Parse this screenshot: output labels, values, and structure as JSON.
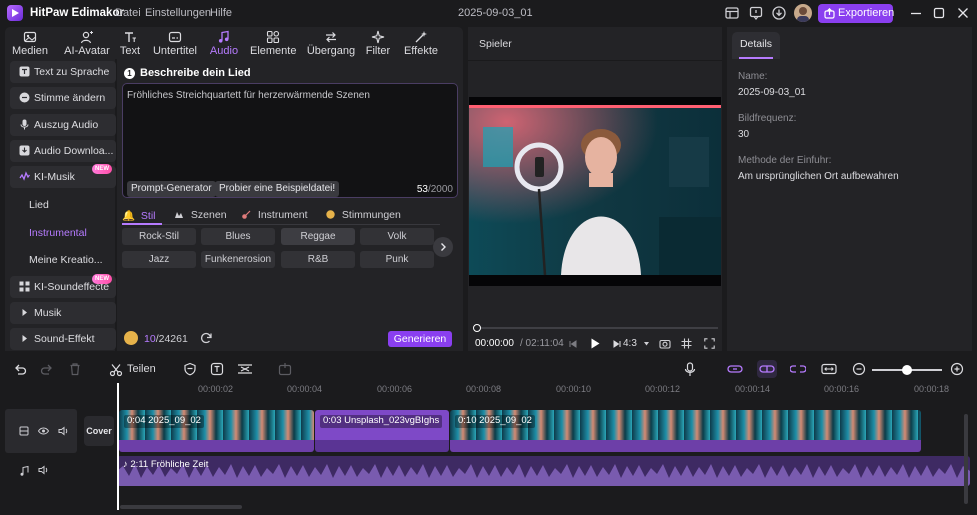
{
  "app": {
    "name": "HitPaw Edimakor",
    "menu": [
      "Datei",
      "Einstellungen",
      "Hilfe"
    ],
    "project_title": "2025-09-03_01",
    "export_label": "Exportieren"
  },
  "tool_tabs": [
    {
      "label": "Medien",
      "icon": "media-icon"
    },
    {
      "label": "AI-Avatar",
      "icon": "avatar-icon"
    },
    {
      "label": "Text",
      "icon": "text-icon"
    },
    {
      "label": "Untertitel",
      "icon": "subtitle-icon"
    },
    {
      "label": "Audio",
      "icon": "music-note-icon",
      "active": true
    },
    {
      "label": "Elemente",
      "icon": "elements-icon"
    },
    {
      "label": "Übergang",
      "icon": "transition-icon"
    },
    {
      "label": "Filter",
      "icon": "filter-icon"
    },
    {
      "label": "Effekte",
      "icon": "effects-icon"
    }
  ],
  "sidebar": {
    "items": [
      {
        "label": "Text zu Sprache",
        "icon": "text-to-speech-icon"
      },
      {
        "label": "Stimme ändern",
        "icon": "voice-change-icon"
      },
      {
        "label": "Auszug Audio",
        "icon": "microphone-icon"
      },
      {
        "label": "Audio Downloa...",
        "icon": "audio-download-icon"
      },
      {
        "label": "KI-Musik",
        "icon": "ai-music-icon",
        "badge": "NEW"
      }
    ],
    "sub_items": [
      {
        "label": "Lied"
      },
      {
        "label": "Instrumental",
        "active": true
      },
      {
        "label": "Meine Kreatio..."
      }
    ],
    "items_bottom": [
      {
        "label": "KI-Soundeffecte",
        "icon": "ai-sound-icon",
        "badge": "NEW"
      },
      {
        "label": "Musik",
        "icon": "caret-right-icon"
      },
      {
        "label": "Sound-Effekt",
        "icon": "caret-right-icon"
      }
    ]
  },
  "music_panel": {
    "step": "1",
    "title": "Beschreibe dein Lied",
    "prompt": "Fröhliches Streichquartett für herzerwärmende Szenen",
    "prompt_generator": "Prompt-Generator",
    "example_button": "Probier eine Beispieldatei!",
    "char_count": "53",
    "char_max": "/2000",
    "style_tabs": [
      "Stil",
      "Szenen",
      "Instrument",
      "Stimmungen"
    ],
    "chips": [
      "Rock-Stil",
      "Blues",
      "Reggae",
      "Volk",
      "Jazz",
      "Funkenerosion",
      "R&B",
      "Punk"
    ],
    "credits_used": "10",
    "credits_total": "/24261",
    "generate_label": "Generieren"
  },
  "player": {
    "title": "Spieler",
    "time_current": "00:00:00",
    "time_total": "/ 02:11:04",
    "aspect": "4:3"
  },
  "details": {
    "tab": "Details",
    "name_label": "Name:",
    "name_value": "2025-09-03_01",
    "fps_label": "Bildfrequenz:",
    "fps_value": "30",
    "import_label": "Methode der Einfuhr:",
    "import_value": "Am ursprünglichen Ort aufbewahren"
  },
  "timeline": {
    "split_label": "Teilen",
    "ticks": [
      "02",
      "04",
      "06",
      "08",
      "10",
      "12",
      "14",
      "16",
      "18"
    ],
    "tick_prefix": "00:00:",
    "cover_label": "Cover",
    "clips": [
      {
        "label": "0:04 2025_09_02"
      },
      {
        "label": "0:03 Unsplash_023vgBIghs"
      },
      {
        "label": "0:10 2025_09_02"
      }
    ],
    "music_label": "2:11 Fröhliche Zeit",
    "zoom_level": 0.45
  },
  "colors": {
    "accent": "#8a3ff0",
    "accent_text": "#b67bff",
    "panel": "#232326",
    "background": "#1b1b1d"
  }
}
